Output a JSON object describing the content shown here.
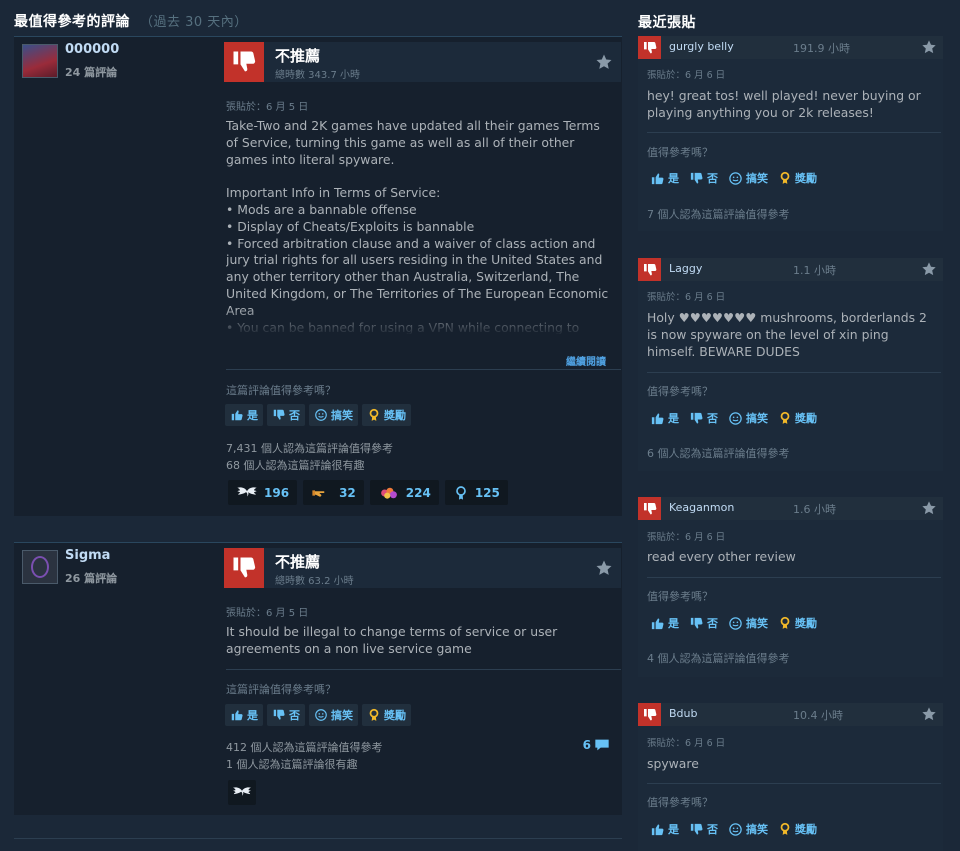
{
  "left_title": "最值得參考的評論",
  "left_subtitle": "（過去 30 天內）",
  "right_title": "最近張貼",
  "reviews": [
    {
      "author": "000000",
      "review_count": "24 篇評論",
      "recommendation": "不推薦",
      "hours": "總時數 343.7 小時",
      "posted": "張貼於：6 月 5 日",
      "text": "Take-Two and 2K games have updated all their games Terms of Service, turning this game as well as all of their other games into literal spyware.\n\nImportant Info in Terms of Service:\n• Mods are a bannable offense\n• Display of Cheats/Exploits is bannable\n• Forced arbitration clause and a waiver of class action and jury trial rights for all users residing in the United States and any other territory other than Australia, Switzerland, The United Kingdom, or The Territories of The European Economic Area\n• You can be banned for using a VPN while connecting to online servers",
      "read_more": "繼續閱讀",
      "helpful_q": "這篇評論值得參考嗎？",
      "btn_yes": "是",
      "btn_no": "否",
      "btn_funny": "搞笑",
      "btn_award": "獎勵",
      "helpful_stat": "7,431 個人認為這篇評論值得參考",
      "funny_stat": "68 個人認為這篇評論很有趣",
      "awards": [
        {
          "icon": "wings-icon",
          "count": "196"
        },
        {
          "icon": "pointing-hand-icon",
          "count": "32"
        },
        {
          "icon": "heart-cluster-icon",
          "count": "224"
        },
        {
          "icon": "medal-icon",
          "count": "125"
        }
      ]
    },
    {
      "author": "Sigma",
      "review_count": "26 篇評論",
      "recommendation": "不推薦",
      "hours": "總時數 63.2 小時",
      "posted": "張貼於：6 月 5 日",
      "text": "It should be illegal to change terms of service or user agreements on a non live service game",
      "helpful_q": "這篇評論值得參考嗎？",
      "btn_yes": "是",
      "btn_no": "否",
      "btn_funny": "搞笑",
      "btn_award": "獎勵",
      "helpful_stat": "412 個人認為這篇評論值得參考",
      "funny_stat": "1 個人認為這篇評論很有趣",
      "comment_count": "6",
      "awards": [
        {
          "icon": "wings-icon"
        }
      ]
    }
  ],
  "recent": [
    {
      "author": "gurgly belly",
      "hours": "191.9 小時",
      "posted": "張貼於：6 月 6 日",
      "text": "hey! great tos! well played! never buying or playing anything you or 2k releases!",
      "helpful_q": "值得參考嗎？",
      "btn_yes": "是",
      "btn_no": "否",
      "btn_funny": "搞笑",
      "btn_award": "獎勵",
      "stat": "7 個人認為這篇評論值得參考"
    },
    {
      "author": "Laggy",
      "hours": "1.1 小時",
      "posted": "張貼於：6 月 6 日",
      "text": "Holy ♥♥♥♥♥♥♥ mushrooms, borderlands 2 is now spyware on the level of xin ping himself. BEWARE DUDES",
      "helpful_q": "值得參考嗎？",
      "btn_yes": "是",
      "btn_no": "否",
      "btn_funny": "搞笑",
      "btn_award": "獎勵",
      "stat": "6 個人認為這篇評論值得參考"
    },
    {
      "author": "Keaganmon",
      "hours": "1.6 小時",
      "posted": "張貼於：6 月 6 日",
      "text": "read every other review",
      "helpful_q": "值得參考嗎？",
      "btn_yes": "是",
      "btn_no": "否",
      "btn_funny": "搞笑",
      "btn_award": "獎勵",
      "stat": "4 個人認為這篇評論值得參考"
    },
    {
      "author": "Bdub",
      "hours": "10.4 小時",
      "posted": "張貼於：6 月 6 日",
      "text": "spyware",
      "helpful_q": "值得參考嗎？",
      "btn_yes": "是",
      "btn_no": "否",
      "btn_funny": "搞笑",
      "btn_award": "獎勵"
    }
  ],
  "colors": {
    "background": "#1b2838",
    "negative": "#c2322a",
    "link": "#67c1f5",
    "award_gold": "#f1b829"
  }
}
